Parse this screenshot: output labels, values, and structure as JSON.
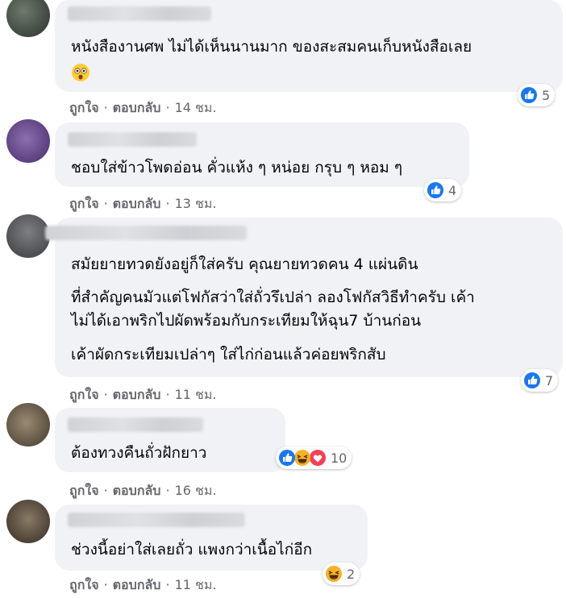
{
  "colors": {
    "bubble": "#f0f2f5",
    "meta_text": "#65676b",
    "like_blue": "#1877f2",
    "love_red": "#f33e58",
    "haha_yellow": "#f7b125"
  },
  "comments": [
    {
      "lines": [
        "หนังสืองานศพ ไม่ได้เห็นนานมาก ของสะสมคนเก็บหนังสือเลย"
      ],
      "emoji": "wow-emoji-icon",
      "reactions": [
        "like-icon"
      ],
      "reaction_count": "5",
      "like": "ถูกใจ",
      "reply": "ตอบกลับ",
      "time": "14 ชม."
    },
    {
      "lines": [
        "ชอบใส่ข้าวโพดอ่อน คั่วแห้ง ๆ หน่อย กรุบ ๆ หอม ๆ"
      ],
      "reactions": [
        "like-icon"
      ],
      "reaction_count": "4",
      "like": "ถูกใจ",
      "reply": "ตอบกลับ",
      "time": "13 ชม."
    },
    {
      "lines": [
        "สมัยยายทวดยังอยู่ก็ใส่ครับ คุณยายทวดคน 4 แผ่นดิน",
        "ที่สำคัญคนมัวแต่โฟกัสว่าใส่ถั่วรึเปล่า ลองโฟกัสวิธีทำครับ เค้า",
        "ไม่ได้เอาพริกไปผัดพร้อมกับกระเทียมให้ฉุน7 บ้านก่อน",
        "เค้าผัดกระเทียมเปล่าๆ ใส่ไก่ก่อนแล้วค่อยพริกสับ"
      ],
      "reactions": [
        "like-icon"
      ],
      "reaction_count": "7",
      "like": "ถูกใจ",
      "reply": "ตอบกลับ",
      "time": "11 ชม."
    },
    {
      "lines": [
        "ต้องทวงคืนถั่วฝักยาว"
      ],
      "reactions": [
        "like-icon",
        "haha-icon",
        "love-icon"
      ],
      "reaction_count": "10",
      "like": "ถูกใจ",
      "reply": "ตอบกลับ",
      "time": "16 ชม."
    },
    {
      "lines": [
        "ช่วงนี้อย่าใส่เลยถั่ว แพงกว่าเนื้อไก่อีก"
      ],
      "reactions": [
        "haha-icon"
      ],
      "reaction_count": "2",
      "like": "ถูกใจ",
      "reply": "ตอบกลับ",
      "time": "11 ชม."
    }
  ]
}
